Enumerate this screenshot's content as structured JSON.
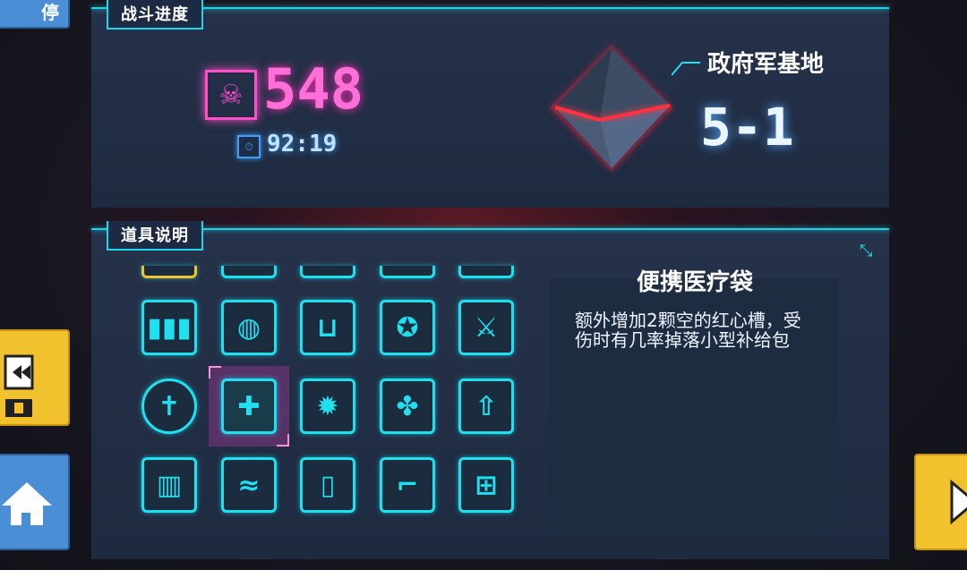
{
  "side_buttons": {
    "top_left_label": "停"
  },
  "battle_progress": {
    "tab_label": "战斗进度",
    "kills": "548",
    "time": "92:19",
    "location": "政府军基地",
    "stage": "5-1"
  },
  "items": {
    "tab_label": "道具说明",
    "grid": [
      [
        "bullets-icon",
        "net-ball-icon",
        "magnet-icon",
        "compass-icon",
        "sword-strike-icon"
      ],
      [
        "cross-shield-icon",
        "medkit-bag-icon",
        "explosion-icon",
        "bone-icon",
        "arrow-plus-icon"
      ],
      [
        "fence-icon",
        "wave-icon",
        "pillar-icon",
        "boot-icon",
        "toolbox-icon"
      ]
    ],
    "selected": "medkit-bag-icon",
    "selected_title": "便携医疗袋",
    "selected_desc": "额外增加2颗空的红心槽，受伤时有几率掉落小型补给包"
  },
  "colors": {
    "accent": "#1fe0ef",
    "kill": "#ff6fd8",
    "timer": "#3fa0ff"
  }
}
